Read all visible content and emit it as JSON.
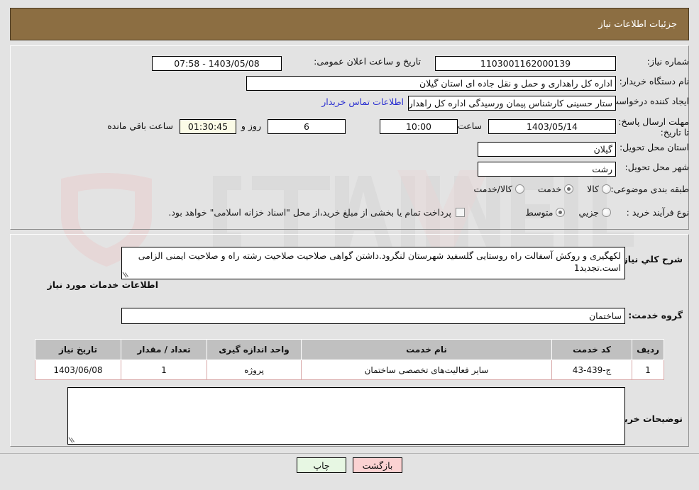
{
  "header": {
    "title": "جزئیات اطلاعات نیاز"
  },
  "form": {
    "need_number_label": "شماره نیاز:",
    "need_number_value": "1103001162000139",
    "announce_label": "تاریخ و ساعت اعلان عمومی:",
    "announce_value": "1403/05/08 - 07:58",
    "buyer_org_label": "نام دستگاه خریدار:",
    "buyer_org_value": "اداره کل راهداری و حمل و نقل جاده ای استان گیلان",
    "requester_label": "ایجاد کننده درخواست:",
    "requester_value": "ستار حسینی کارشناس پیمان ورسیدگی اداره کل راهداری و حمل و نقل جاده ا",
    "contact_link": "اطلاعات تماس خریدار",
    "deadline_label": "مهلت ارسال پاسخ: تا تاریخ:",
    "deadline_date": "1403/05/14",
    "hour_label": "ساعت",
    "deadline_time": "10:00",
    "days_remaining": "6",
    "days_unit_label": "روز و",
    "timer_value": "01:30:45",
    "timer_suffix_label": "ساعت باقي مانده",
    "province_label": "استان محل تحویل:",
    "province_value": "گیلان",
    "city_label": "شهر محل تحویل:",
    "city_value": "رشت",
    "category_label": "طبقه بندی موضوعی:",
    "category_options": [
      {
        "label": "کالا",
        "selected": false
      },
      {
        "label": "خدمت",
        "selected": true
      },
      {
        "label": "کالا/خدمت",
        "selected": false
      }
    ],
    "process_label": "نوع فرآیند خرید :",
    "process_options": [
      {
        "label": "جزیي",
        "selected": false
      },
      {
        "label": "متوسط",
        "selected": true
      }
    ],
    "treasury_checkbox_label": "پرداخت تمام یا بخشی از مبلغ خرید،از محل \"اسناد خزانه اسلامی\" خواهد بود.",
    "treasury_checked": false
  },
  "description": {
    "label": "شرح کلي نیاز:",
    "value": "لکهگیری و روکش آسفالت راه روستایی گلسفید شهرستان لنگرود.داشتن گواهی صلاحیت صلاحیت رشته راه و صلاحیت ایمنی الزامی است.تجدید1"
  },
  "services": {
    "section_title": "اطلاعات خدمات مورد نیاز",
    "group_label": "گروه خدمت:",
    "group_value": "ساختمان",
    "table": {
      "columns": [
        "ردیف",
        "کد خدمت",
        "نام خدمت",
        "واحد اندازه گیری",
        "تعداد / مقدار",
        "تاریخ نیاز"
      ],
      "rows": [
        [
          "1",
          "ج-439-43",
          "سایر فعالیت‌های تخصصی ساختمان",
          "پروژه",
          "1",
          "1403/06/08"
        ]
      ]
    }
  },
  "comments": {
    "label": "توضیحات خریدار:",
    "value": ""
  },
  "buttons": {
    "print": "چاپ",
    "back": "بازگشت"
  },
  "watermark": {
    "text": "AriaTender.net"
  },
  "colors": {
    "header_brown": "#8c6e42",
    "page_bg": "#e3e3e3",
    "link_blue": "#2b30d0",
    "timer_bg": "#fbfbe7",
    "print_btn": "#e7f7e3",
    "back_btn": "#fbd2d2",
    "table_header": "#c0c0c0"
  }
}
